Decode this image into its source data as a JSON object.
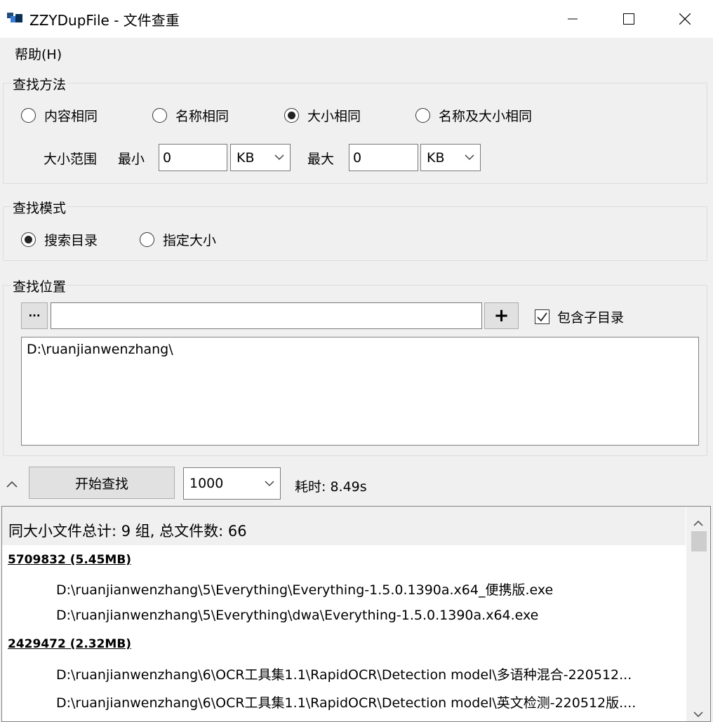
{
  "window": {
    "title": "ZZYDupFile - 文件查重",
    "icon": "app-icon",
    "controls": [
      "minimize-icon",
      "maximize-icon",
      "close-icon"
    ]
  },
  "menu": {
    "help": "帮助(H)"
  },
  "method_group": {
    "label": "查找方法",
    "options": [
      "内容相同",
      "名称相同",
      "大小相同",
      "名称及大小相同"
    ],
    "selected": "大小相同",
    "size_range_label": "大小范围",
    "min_label": "最小",
    "min_value": "0",
    "min_unit": "KB",
    "max_label": "最大",
    "max_value": "0",
    "max_unit": "KB"
  },
  "mode_group": {
    "label": "查找模式",
    "options": [
      "搜索目录",
      "指定大小"
    ],
    "selected": "搜索目录"
  },
  "location_group": {
    "label": "查找位置",
    "browse_label": "···",
    "path_value": "",
    "add_label": "+",
    "include_subdirs_label": "包含子目录",
    "include_subdirs_checked": true,
    "paths": [
      "D:\\ruanjianwenzhang\\"
    ]
  },
  "action": {
    "start_label": "开始查找",
    "limit_value": "1000",
    "elapsed": "耗时: 8.49s"
  },
  "results": {
    "summary": "同大小文件总计: 9 组, 总文件数: 66",
    "groups": [
      {
        "header": "5709832 (5.45MB)",
        "files": [
          "D:\\ruanjianwenzhang\\5\\Everything\\Everything-1.5.0.1390a.x64_便携版.exe",
          "D:\\ruanjianwenzhang\\5\\Everything\\dwa\\Everything-1.5.0.1390a.x64.exe"
        ]
      },
      {
        "header": "2429472 (2.32MB)",
        "files": [
          "D:\\ruanjianwenzhang\\6\\OCR工具集1.1\\RapidOCR\\Detection model\\多语种混合-220512...",
          "D:\\ruanjianwenzhang\\6\\OCR工具集1.1\\RapidOCR\\Detection model\\英文检测-220512版...."
        ]
      }
    ]
  }
}
